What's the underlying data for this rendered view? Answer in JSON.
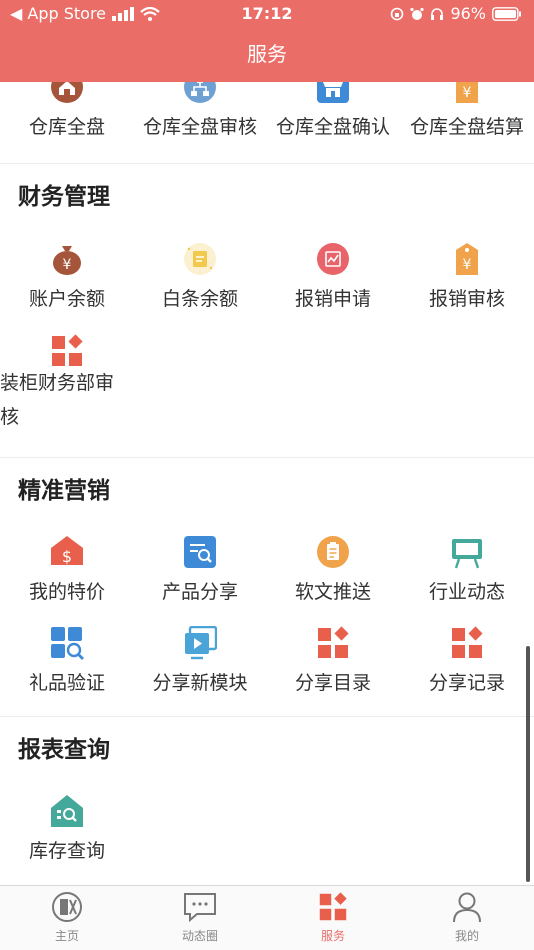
{
  "status_bar": {
    "back_app": "◀ App Store",
    "time": "17:12",
    "battery": "96%"
  },
  "nav": {
    "title": "服务"
  },
  "warehouse_section": {
    "items": [
      {
        "label": "仓库全盘",
        "icon": "warehouse-icon"
      },
      {
        "label": "仓库全盘审核",
        "icon": "org-chart-icon"
      },
      {
        "label": "仓库全盘确认",
        "icon": "store-icon"
      },
      {
        "label": "仓库全盘结算",
        "icon": "yen-tag-icon"
      }
    ]
  },
  "finance_section": {
    "title": "财务管理",
    "items": [
      {
        "label": "账户余额",
        "icon": "money-bag-icon"
      },
      {
        "label": "白条余额",
        "icon": "note-icon"
      },
      {
        "label": "报销申请",
        "icon": "chart-circle-icon"
      },
      {
        "label": "报销审核",
        "icon": "yen-tag-icon"
      }
    ],
    "extra_item": {
      "label_line1": "装柜财务部审",
      "label_line2": "核",
      "icon": "grid-diamond-icon"
    }
  },
  "marketing_section": {
    "title": "精准营销",
    "items": [
      {
        "label": "我的特价",
        "icon": "dollar-tag-icon"
      },
      {
        "label": "产品分享",
        "icon": "search-doc-icon"
      },
      {
        "label": "软文推送",
        "icon": "clipboard-icon"
      },
      {
        "label": "行业动态",
        "icon": "easel-icon"
      },
      {
        "label": "礼品验证",
        "icon": "grid-search-icon"
      },
      {
        "label": "分享新模块",
        "icon": "video-icon"
      },
      {
        "label": "分享目录",
        "icon": "grid-diamond-icon"
      },
      {
        "label": "分享记录",
        "icon": "grid-diamond-icon"
      }
    ]
  },
  "report_section": {
    "title": "报表查询",
    "items": [
      {
        "label": "库存查询",
        "icon": "house-search-icon"
      }
    ]
  },
  "tabbar": {
    "items": [
      {
        "label": "主页",
        "icon": "home-icon"
      },
      {
        "label": "动态圈",
        "icon": "chat-icon"
      },
      {
        "label": "服务",
        "icon": "grid-diamond-icon",
        "active": true
      },
      {
        "label": "我的",
        "icon": "person-icon"
      }
    ]
  },
  "colors": {
    "accent": "#eb6d67",
    "brown": "#a5553a",
    "blue": "#3e8ad6",
    "orange": "#f0a34a",
    "teal": "#44a99a"
  }
}
